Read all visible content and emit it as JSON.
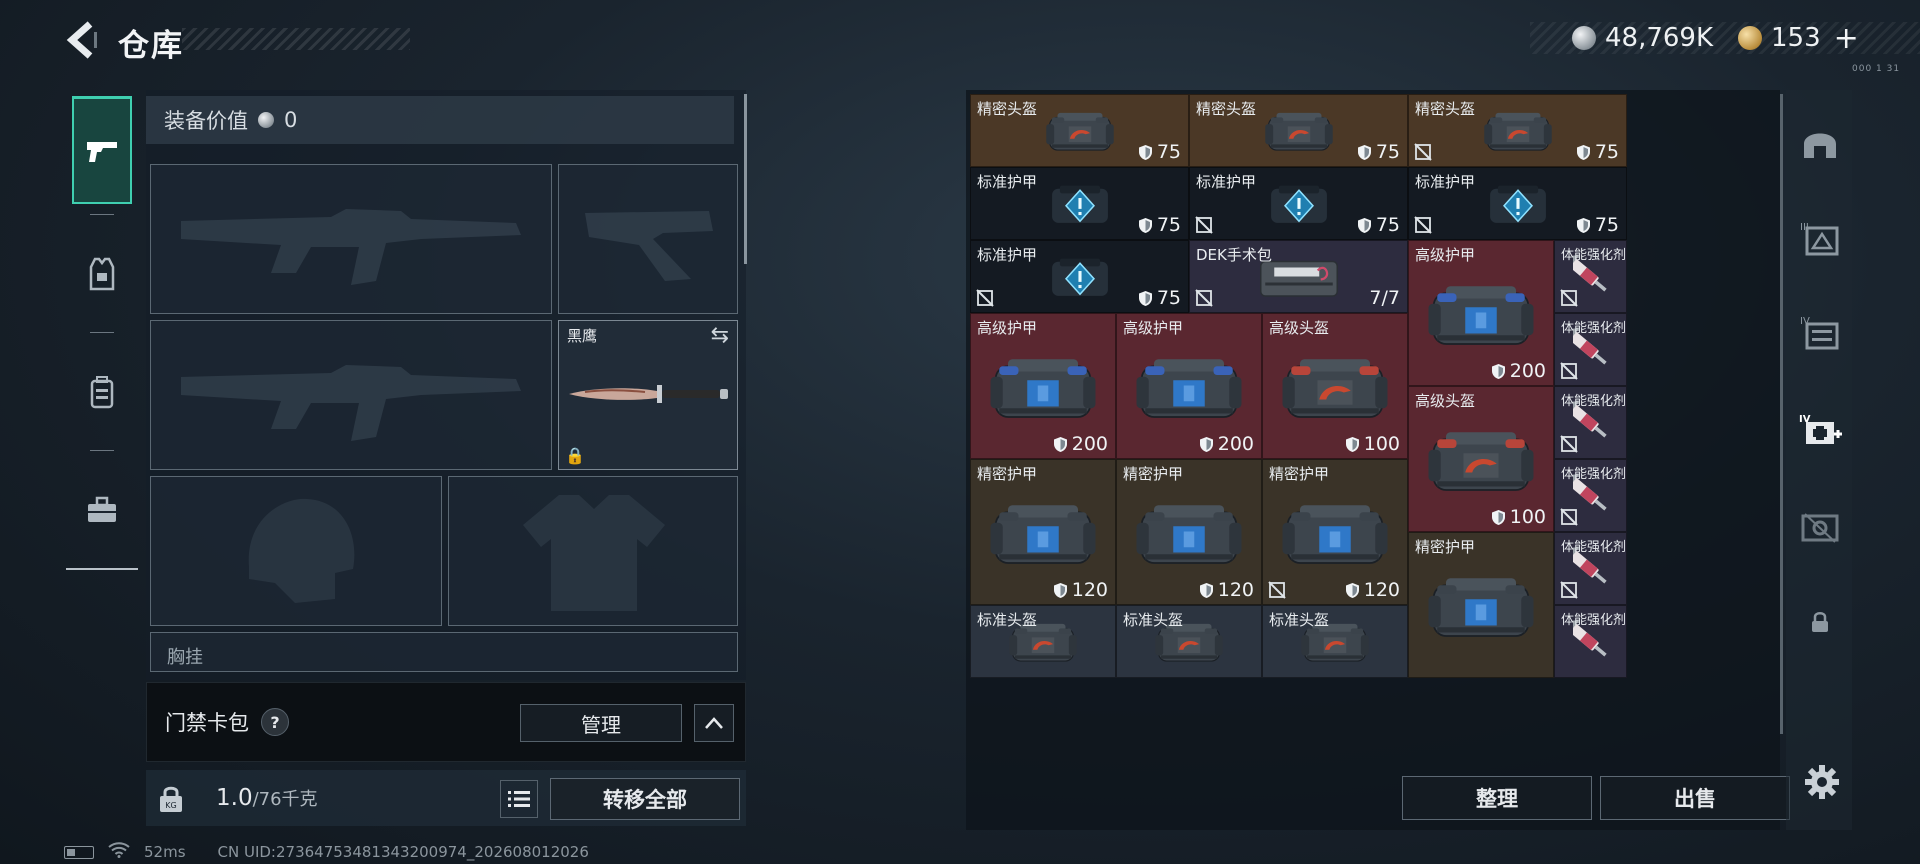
{
  "header": {
    "title": "仓库"
  },
  "currency": {
    "silver": "48,769K",
    "gold": "153",
    "plus": "+"
  },
  "top_small_text": "000 1 31",
  "loadout": {
    "equipment_value_label": "装备价值",
    "equipment_value": "0",
    "melee_name": "黑鹰",
    "chest_slot_label": "胸挂"
  },
  "card_pack": {
    "label": "门禁卡包",
    "help": "?",
    "manage": "管理"
  },
  "weight": {
    "current": "1.0",
    "max": "/76千克",
    "lock_badge": "KG"
  },
  "transfer_all": "转移全部",
  "status": {
    "ping": "52ms",
    "uid": "CN UID:27364753481343200974_202608012026"
  },
  "stash_actions": {
    "sort": "整理",
    "sell": "出售"
  },
  "right_tabs": [
    {
      "icon": "helmet-tab-icon",
      "label": ""
    },
    {
      "icon": "tier-three-tab-icon",
      "label": "III"
    },
    {
      "icon": "tier-four-tab-icon",
      "label": "IV"
    },
    {
      "icon": "tier-four-plus-tab-icon",
      "label": "IV"
    },
    {
      "icon": "tier-five-tab-icon",
      "label": ""
    }
  ],
  "colors": {
    "accent": "#3fcfb0",
    "brown": "#4b3826",
    "red": "#5a2730",
    "purple": "#2d2c3f",
    "dark": "#141a22"
  },
  "stash_items": [
    {
      "label": "精密头盔",
      "value": "75",
      "kind": "helmet",
      "bg": "brown",
      "no_insure": false
    },
    {
      "label": "精密头盔",
      "value": "75",
      "kind": "helmet",
      "bg": "brown",
      "no_insure": false
    },
    {
      "label": "精密头盔",
      "value": "75",
      "kind": "helmet",
      "bg": "brown",
      "no_insure": true
    },
    {
      "label": "标准护甲",
      "value": "75",
      "kind": "std",
      "bg": "dark",
      "no_insure": false
    },
    {
      "label": "标准护甲",
      "value": "75",
      "kind": "std",
      "bg": "dark",
      "no_insure": true
    },
    {
      "label": "标准护甲",
      "value": "75",
      "kind": "std",
      "bg": "dark",
      "no_insure": true
    },
    {
      "label": "标准护甲",
      "value": "75",
      "kind": "std",
      "bg": "dark",
      "no_insure": true
    },
    {
      "label": "DEK手术包",
      "value": "7/7",
      "kind": "kit",
      "bg": "purple",
      "no_insure": true
    },
    {
      "label": "高级护甲",
      "value": "200",
      "kind": "armor-blue",
      "bg": "red",
      "no_insure": false
    },
    {
      "label": "体能强化剂",
      "value": "",
      "kind": "syringe",
      "bg": "purple",
      "no_insure": true
    },
    {
      "label": "高级护甲",
      "value": "200",
      "kind": "armor-blue",
      "bg": "red",
      "no_insure": false
    },
    {
      "label": "高级护甲",
      "value": "200",
      "kind": "armor-blue",
      "bg": "red",
      "no_insure": false
    },
    {
      "label": "高级头盔",
      "value": "100",
      "kind": "armor-red",
      "bg": "red",
      "no_insure": false
    },
    {
      "label": "体能强化剂",
      "value": "",
      "kind": "syringe",
      "bg": "purple",
      "no_insure": true
    },
    {
      "label": "高级头盔",
      "value": "100",
      "kind": "armor-red",
      "bg": "red",
      "no_insure": false
    },
    {
      "label": "体能强化剂",
      "value": "",
      "kind": "syringe",
      "bg": "purple",
      "no_insure": true
    },
    {
      "label": "精密护甲",
      "value": "120",
      "kind": "armor-plain",
      "bg": "olive",
      "no_insure": false
    },
    {
      "label": "精密护甲",
      "value": "120",
      "kind": "armor-plain",
      "bg": "olive",
      "no_insure": false
    },
    {
      "label": "精密护甲",
      "value": "120",
      "kind": "armor-plain",
      "bg": "olive",
      "no_insure": true
    },
    {
      "label": "体能强化剂",
      "value": "",
      "kind": "syringe",
      "bg": "purple",
      "no_insure": true
    },
    {
      "label": "精密护甲",
      "value": "",
      "kind": "armor-plain",
      "bg": "olive",
      "no_insure": false
    },
    {
      "label": "体能强化剂",
      "value": "",
      "kind": "syringe",
      "bg": "purple",
      "no_insure": true
    },
    {
      "label": "标准头盔",
      "value": "",
      "kind": "helmet",
      "bg": "slate",
      "no_insure": false
    },
    {
      "label": "标准头盔",
      "value": "",
      "kind": "helmet",
      "bg": "slate",
      "no_insure": false
    },
    {
      "label": "标准头盔",
      "value": "",
      "kind": "helmet",
      "bg": "slate",
      "no_insure": false
    },
    {
      "label": "体能强化剂",
      "value": "",
      "kind": "syringe",
      "bg": "purple",
      "no_insure": false
    }
  ]
}
